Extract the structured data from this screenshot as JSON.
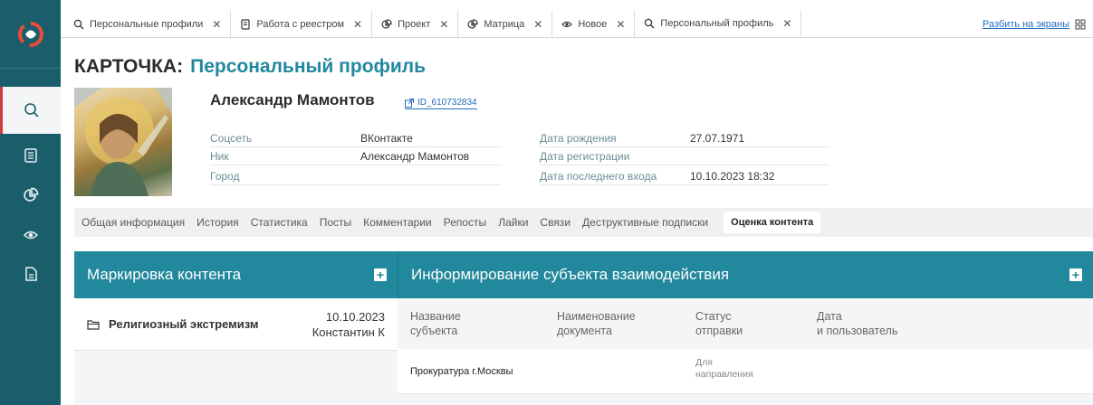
{
  "tabs": [
    {
      "label": "Персональные профили",
      "icon": "search-icon"
    },
    {
      "label": "Работа с реестром",
      "icon": "register-icon"
    },
    {
      "label": "Проект",
      "icon": "pie-chart-icon"
    },
    {
      "label": "Матрица",
      "icon": "pie-chart-icon"
    },
    {
      "label": "Новое",
      "icon": "eye-icon"
    },
    {
      "label": "Персональный профиль",
      "icon": "search-icon"
    }
  ],
  "split_label": "Разбить на экраны",
  "title": {
    "prefix": "КАРТОЧКА:",
    "name": "Персональный профиль"
  },
  "person": {
    "name": "Александр Мамонтов",
    "id": "ID_610732834"
  },
  "info_left": [
    {
      "label": "Соцсеть",
      "value": "ВКонтакте"
    },
    {
      "label": "Ник",
      "value": "Александр Мамонтов"
    },
    {
      "label": "Город",
      "value": ""
    }
  ],
  "info_right": [
    {
      "label": "Дата рождения",
      "value": "27.07.1971"
    },
    {
      "label": "Дата регистрации",
      "value": ""
    },
    {
      "label": "Дата последнего входа",
      "value": "10.10.2023 18:32"
    }
  ],
  "content_tabs": [
    "Общая информация",
    "История",
    "Статистика",
    "Посты",
    "Комментарии",
    "Репосты",
    "Лайки",
    "Связи",
    "Деструктивные подписки",
    "Оценка контента"
  ],
  "marking": {
    "title": "Маркировка контента",
    "plus": "+",
    "items": [
      {
        "name": "Религиозный экстремизм",
        "date": "10.10.2023",
        "user": "Константин К"
      }
    ]
  },
  "informing": {
    "title": "Информирование субъекта взаимодействия",
    "plus": "+",
    "columns": [
      {
        "line1": "Название",
        "line2": "субъекта"
      },
      {
        "line1": "Наименование",
        "line2": "документа"
      },
      {
        "line1": "Статус",
        "line2": "отправки"
      },
      {
        "line1": "Дата",
        "line2": "и пользователь"
      }
    ],
    "rows": [
      {
        "subject": "Прокуратура г.Москвы",
        "document": "",
        "status_line1": "Для",
        "status_line2": "направления",
        "date": ""
      }
    ]
  },
  "colors": {
    "rail": "#1b5e6b",
    "accent": "#21889d",
    "link": "#1e6bbd",
    "active_marker": "#d23a3a"
  }
}
